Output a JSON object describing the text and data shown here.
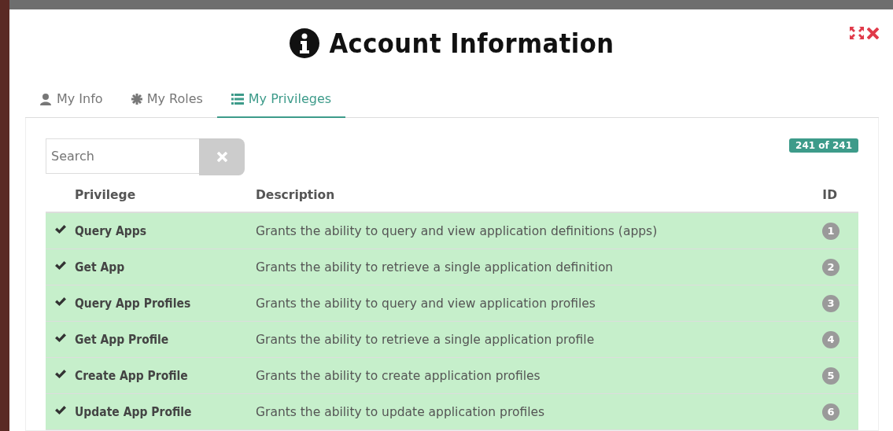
{
  "dialog": {
    "title": "Account Information"
  },
  "tabs": [
    {
      "label": "My Info",
      "selected": false
    },
    {
      "label": "My Roles",
      "selected": false
    },
    {
      "label": "My Privileges",
      "selected": true
    }
  ],
  "search": {
    "placeholder": "Search"
  },
  "count_badge": "241 of 241",
  "table": {
    "columns": [
      "Privilege",
      "Description",
      "ID"
    ],
    "rows": [
      {
        "granted": true,
        "privilege": "Query Apps",
        "description": "Grants the ability to query and view application definitions (apps)",
        "id": "1"
      },
      {
        "granted": true,
        "privilege": "Get App",
        "description": "Grants the ability to retrieve a single application definition",
        "id": "2"
      },
      {
        "granted": true,
        "privilege": "Query App Profiles",
        "description": "Grants the ability to query and view application profiles",
        "id": "3"
      },
      {
        "granted": true,
        "privilege": "Get App Profile",
        "description": "Grants the ability to retrieve a single application profile",
        "id": "4"
      },
      {
        "granted": true,
        "privilege": "Create App Profile",
        "description": "Grants the ability to create application profiles",
        "id": "5"
      },
      {
        "granted": true,
        "privilege": "Update App Profile",
        "description": "Grants the ability to update application profiles",
        "id": "6"
      }
    ]
  }
}
